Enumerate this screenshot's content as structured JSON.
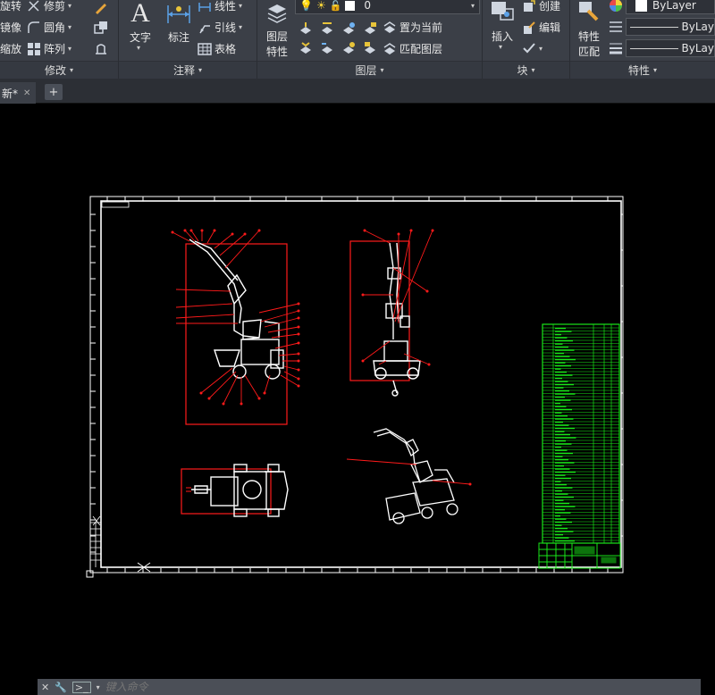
{
  "ribbon": {
    "modify": {
      "title": "修改",
      "rotate": "旋转",
      "trim": "修剪",
      "mirror": "镜像",
      "fillet": "圆角",
      "scale": "缩放",
      "array": "阵列"
    },
    "annotation": {
      "title": "注释",
      "text": "文字",
      "dimension": "标注",
      "linear": "线性",
      "leader": "引线",
      "table": "表格"
    },
    "layers": {
      "title": "图层",
      "layer_properties": "图层\n特性",
      "layer_properties_line1": "图层",
      "layer_properties_line2": "特性",
      "current_layer": "0",
      "set_current": "置为当前",
      "match_layer": "匹配图层"
    },
    "block": {
      "title": "块",
      "insert": "插入",
      "create": "创建",
      "edit": "编辑"
    },
    "properties": {
      "title": "特性",
      "match_line1": "特性",
      "match_line2": "匹配",
      "color": "ByLayer",
      "linetype": "ByLay",
      "lineweight": "ByLay"
    }
  },
  "tabs": {
    "document": "新*",
    "add": "+"
  },
  "command": {
    "placeholder": "键入命令"
  },
  "colors": {
    "drawing_white": "#ffffff",
    "annotation_red": "#ff1a1a",
    "table_green": "#19e619",
    "ribbon_bg": "#3b3f47"
  }
}
